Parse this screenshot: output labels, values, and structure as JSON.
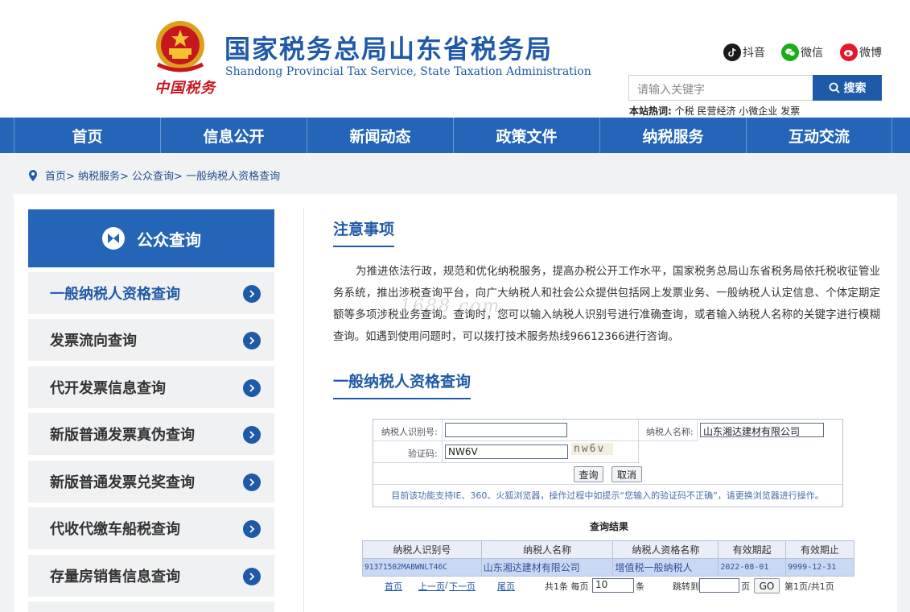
{
  "header": {
    "title": "国家税务总局山东省税务局",
    "subtitle": "Shandong Provincial Tax Service, State Taxation Administration",
    "signature": "中国税务",
    "social": [
      {
        "label": "抖音",
        "icon": "douyin-icon",
        "color": "#1a1a1a"
      },
      {
        "label": "微信",
        "icon": "wechat-icon",
        "color": "#1aad19"
      },
      {
        "label": "微博",
        "icon": "weibo-icon",
        "color": "#e6162d"
      }
    ],
    "search": {
      "placeholder": "请输入关键字",
      "button": "搜索"
    },
    "hot": {
      "label": "本站热词:",
      "words": "个税 民营经济 小微企业 发票"
    }
  },
  "nav": [
    "首页",
    "信息公开",
    "新闻动态",
    "政策文件",
    "纳税服务",
    "互动交流"
  ],
  "breadcrumb": "首页> 纳税服务> 公众查询> 一般纳税人资格查询",
  "sidebar": {
    "title": "公众查询",
    "items": [
      "一般纳税人资格查询",
      "发票流向查询",
      "代开发票信息查询",
      "新版普通发票真伪查询",
      "新版普通发票兑奖查询",
      "代收代缴车船税查询",
      "存量房销售信息查询"
    ]
  },
  "notice": {
    "title": "注意事项",
    "text": "为推进依法行政，规范和优化纳税服务，提高办税公开工作水平，国家税务总局山东省税务局依托税收征管业务系统，推出涉税查询平台，向广大纳税人和社会公众提供包括网上发票业务、一般纳税人认定信息、个体定期定额等多项涉税业务查询。查询时，您可以输入纳税人识别号进行准确查询，或者输入纳税人名称的关键字进行模糊查询。如遇到使用问题时，可以拨打技术服务热线96612366进行咨询。"
  },
  "watermark": "1688.com",
  "query": {
    "title": "一般纳税人资格查询",
    "id_label": "纳税人识别号:",
    "id_value": "",
    "name_label": "纳税人名称:",
    "name_value": "山东湘达建材有限公司",
    "code_label": "验证码:",
    "code_value": "NW6V",
    "captcha_text": "nw6v",
    "query_button": "查询",
    "cancel_button": "取消",
    "tip": "目前该功能支持IE、360、火狐浏览器，操作过程中如提示“您输入的验证码不正确”，请更换浏览器进行操作。"
  },
  "results": {
    "title": "查询结果",
    "columns": [
      "纳税人识别号",
      "纳税人名称",
      "纳税人资格名称",
      "有效期起",
      "有效期止"
    ],
    "rows": [
      [
        "91371502MABWNLT46C",
        "山东湘达建材有限公司",
        "增值税一般纳税人",
        "2022-08-01",
        "9999-12-31"
      ]
    ],
    "pager": {
      "first": "首页",
      "prev": "上一页",
      "sep": "/",
      "next": "下一页",
      "last": "尾页",
      "total": "共1条 每页",
      "per_page": "10",
      "unit": "条",
      "jump_label": "跳转到",
      "jump_value": "",
      "page_unit": "页",
      "go": "GO",
      "status": "第1页/共1页"
    }
  }
}
